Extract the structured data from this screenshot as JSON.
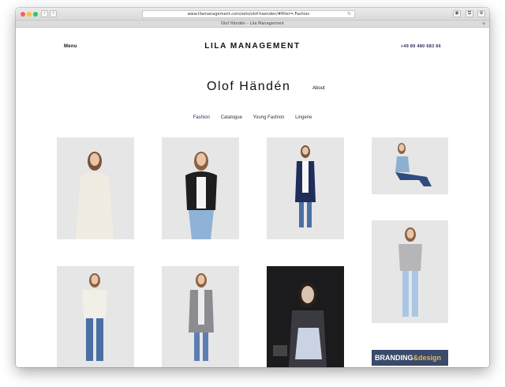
{
  "browser": {
    "url": "www.lilamanagement.com/sets/olof-haenden/#filter=.Fashion",
    "tab_title": "Olof Händén – Lila Management",
    "back_glyph": "‹",
    "forward_glyph": "›",
    "reload_glyph": "↻",
    "tab_plus": "+",
    "toolbar_icons": [
      "◉",
      "⧉",
      "⊕"
    ]
  },
  "header": {
    "menu_label": "Menu",
    "brand": "LILA MANAGEMENT",
    "phone": "+49 89 480 683 66"
  },
  "model": {
    "name": "Olof Händén",
    "about_label": "About"
  },
  "categories": [
    {
      "label": "Fashion",
      "active": true
    },
    {
      "label": "Catalogue",
      "active": false
    },
    {
      "label": "Young Fashion",
      "active": false
    },
    {
      "label": "Lingerie",
      "active": false
    }
  ],
  "gallery": {
    "last_tile_title": "BRANDING",
    "last_tile_title_tail": "&design"
  },
  "colors": {
    "accent": "#2a2a6a",
    "photo_bg": "#e6e6e6"
  }
}
